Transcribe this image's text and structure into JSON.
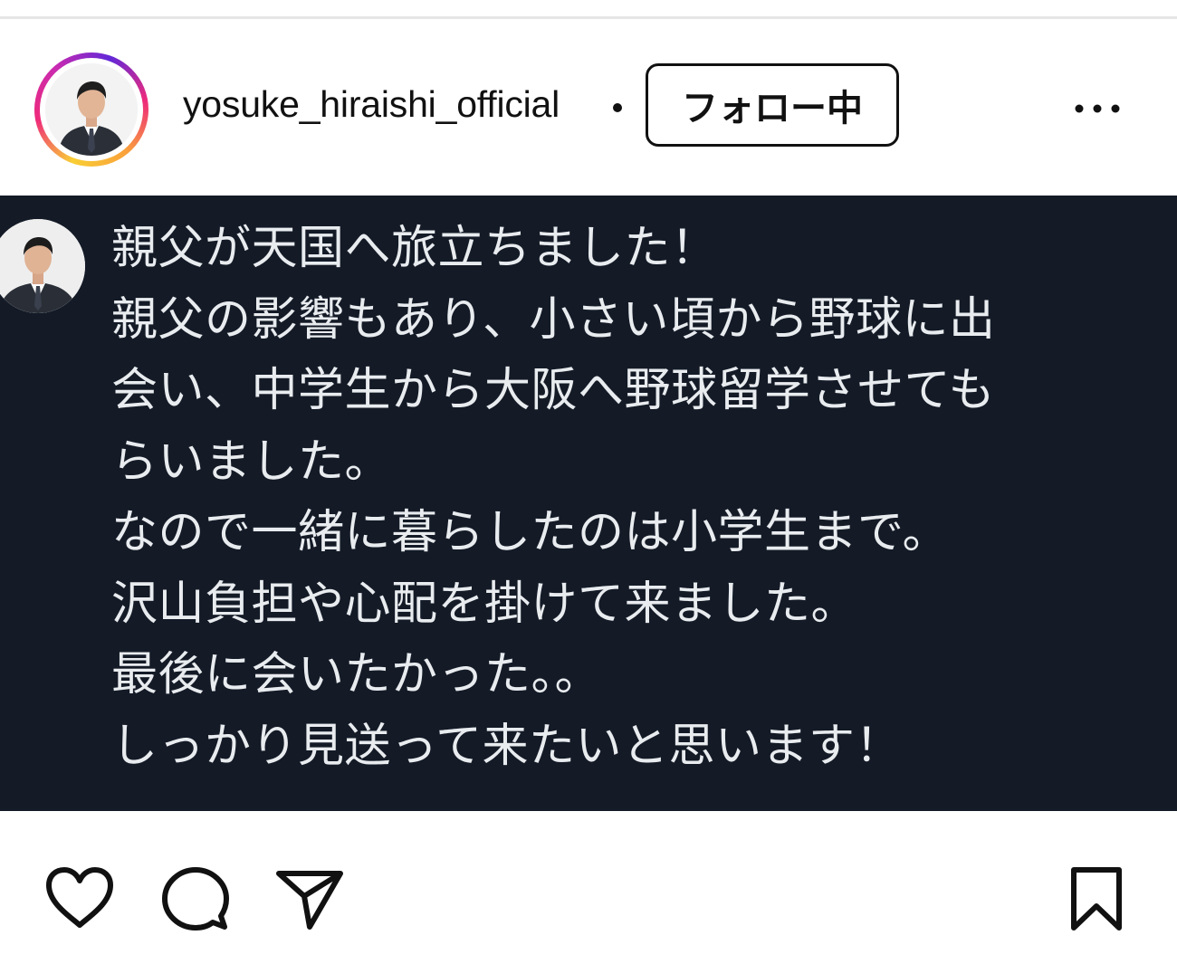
{
  "header": {
    "username": "yosuke_hiraishi_official",
    "separator": "•",
    "follow_label": "フォロー中",
    "more_icon": "more-horizontal-icon"
  },
  "post": {
    "background_color": "#141b27",
    "text_color": "#e9ecef",
    "lines": [
      "親父が天国へ旅立ちました！",
      "親父の影響もあり、小さい頃から野球に出",
      "会い、中学生から大阪へ野球留学させても",
      "らいました。",
      "なので一緒に暮らしたのは小学生まで。",
      "沢山負担や心配を掛けて来ました。",
      "最後に会いたかった。。",
      "しっかり見送って来たいと思います！"
    ]
  },
  "actions": {
    "like_icon": "heart-icon",
    "comment_icon": "comment-icon",
    "share_icon": "send-icon",
    "save_icon": "bookmark-icon"
  }
}
